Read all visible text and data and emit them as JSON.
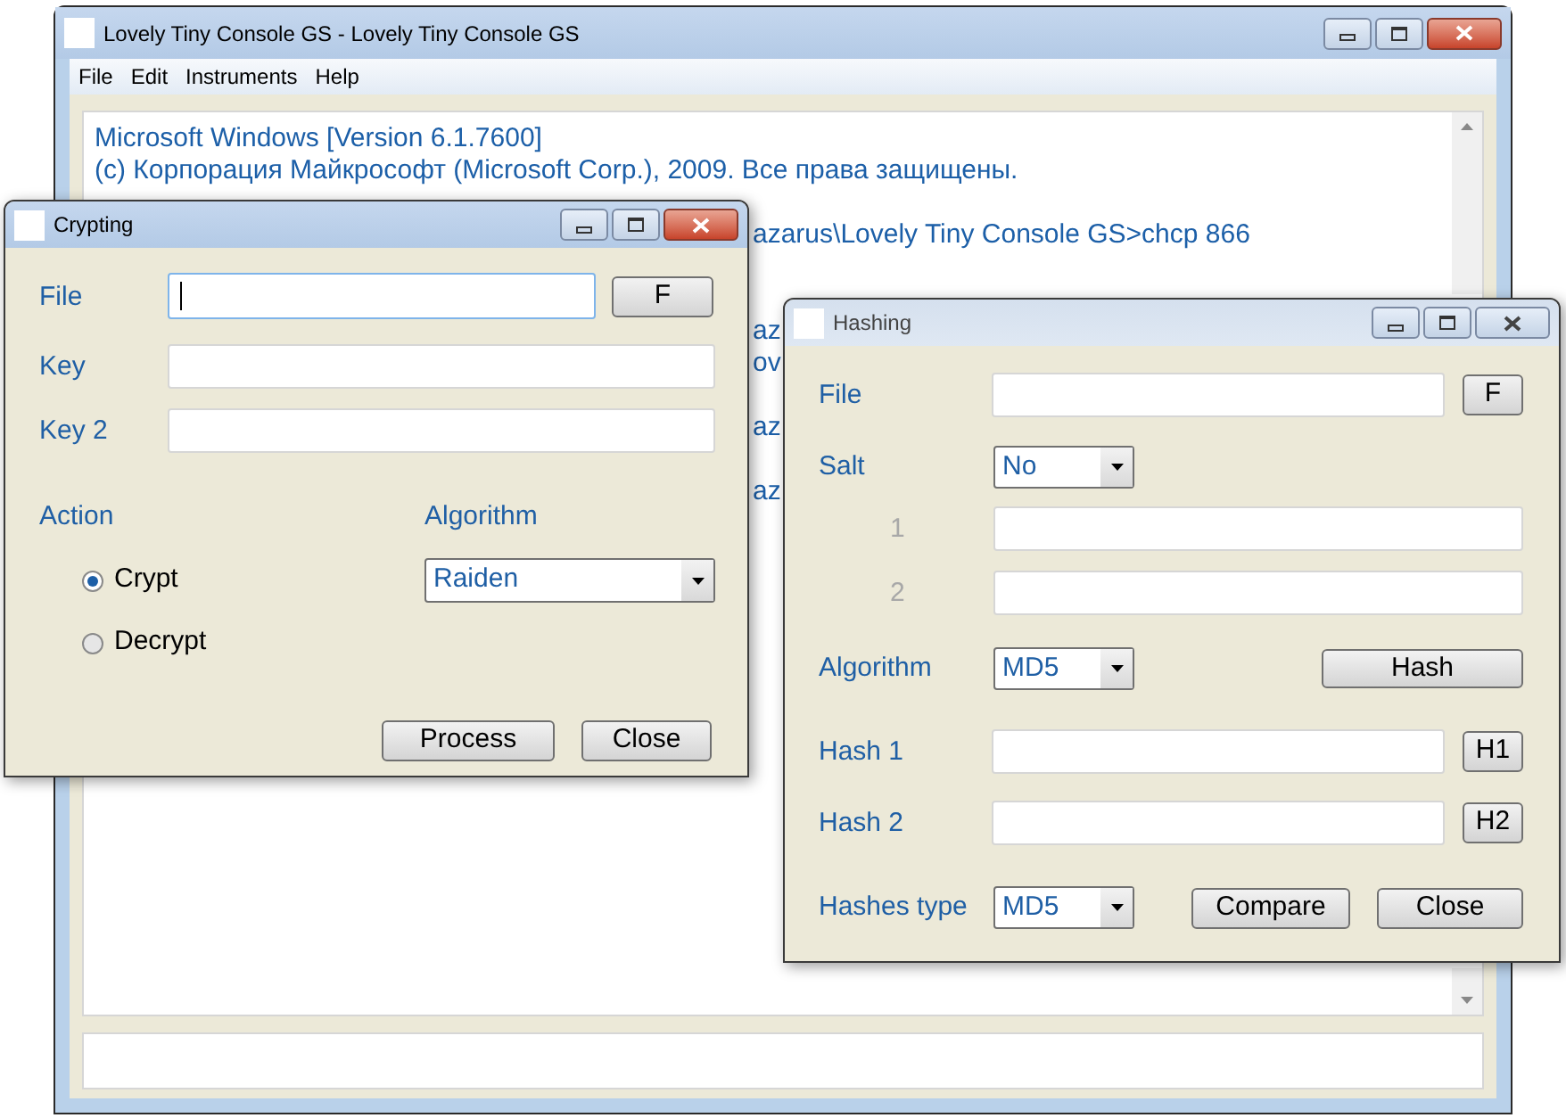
{
  "main_window": {
    "title": "Lovely Tiny Console GS - Lovely Tiny Console GS",
    "active": true,
    "menu": [
      "File",
      "Edit",
      "Instruments",
      "Help"
    ],
    "console_lines": [
      {
        "kind": "text",
        "text": "Microsoft Windows [Version 6.1.7600]"
      },
      {
        "kind": "text",
        "text": "(c) Корпорация Майкрософт (Microsoft Corp.), 2009. Все права защищены."
      },
      {
        "kind": "blank"
      },
      {
        "kind": "cut",
        "text": "azarus\\Lovely Tiny Console GS>chcp 866"
      },
      {
        "kind": "blank"
      },
      {
        "kind": "blank"
      },
      {
        "kind": "cut",
        "text": "az"
      },
      {
        "kind": "cut",
        "text": "ov"
      },
      {
        "kind": "blank"
      },
      {
        "kind": "cut",
        "text": "az"
      },
      {
        "kind": "blank"
      },
      {
        "kind": "cut",
        "text": "az"
      }
    ]
  },
  "crypting": {
    "title": "Crypting",
    "active": true,
    "file": {
      "label": "File",
      "focused": true,
      "button": "F"
    },
    "key": {
      "label": "Key"
    },
    "key2": {
      "label": "Key 2"
    },
    "action": {
      "label": "Action",
      "options": [
        {
          "label": "Crypt",
          "selected": true
        },
        {
          "label": "Decrypt",
          "selected": false
        }
      ]
    },
    "algorithm": {
      "label": "Algorithm",
      "value": "Raiden"
    },
    "buttons": [
      "Process",
      "Close"
    ]
  },
  "hashing": {
    "title": "Hashing",
    "active": false,
    "file": {
      "label": "File",
      "button": "F"
    },
    "salt": {
      "label": "Salt",
      "value": "No",
      "fields": [
        {
          "label": "1",
          "disabled": true
        },
        {
          "label": "2",
          "disabled": true
        }
      ]
    },
    "algorithm": {
      "label": "Algorithm",
      "value": "MD5",
      "button": "Hash"
    },
    "hashes": [
      {
        "label": "Hash 1",
        "button": "H1"
      },
      {
        "label": "Hash 2",
        "button": "H2"
      }
    ],
    "hashes_type": {
      "label": "Hashes type",
      "value": "MD5"
    },
    "buttons": [
      "Compare",
      "Close"
    ]
  }
}
